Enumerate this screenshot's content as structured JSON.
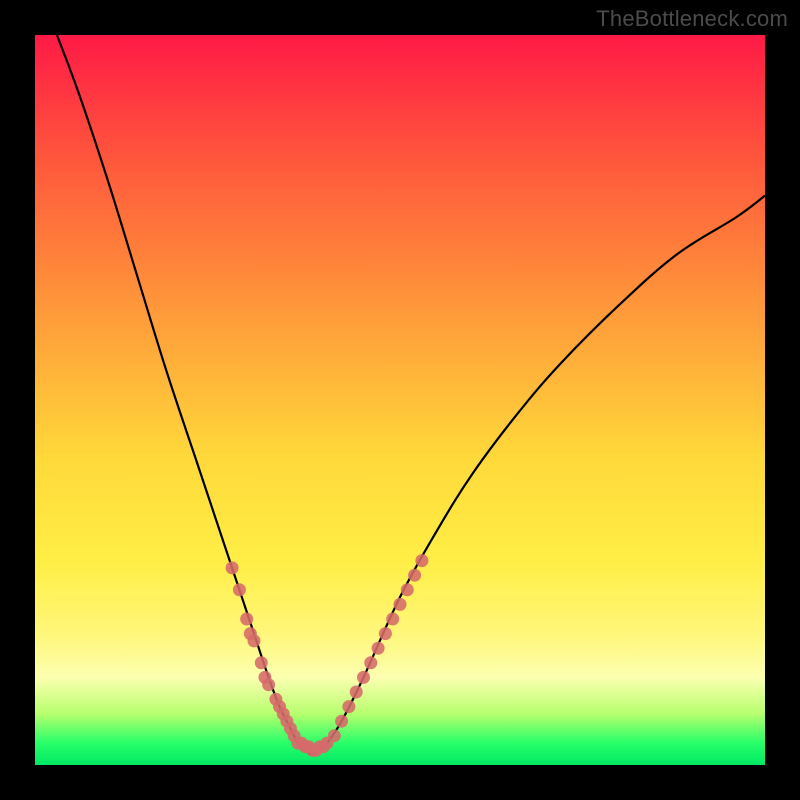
{
  "watermark": "TheBottleneck.com",
  "colors": {
    "frame": "#000000",
    "grad_top": "#ff1a46",
    "grad_red_orange": "#ff5a3c",
    "grad_orange": "#ff9a3a",
    "grad_yellow_upper": "#ffd93a",
    "grad_yellow": "#ffee45",
    "grad_yellow_pale": "#fff77a",
    "grad_yellow_white": "#fcffb0",
    "grad_green_light": "#b6ff6e",
    "grad_green": "#28ff6a",
    "grad_green_deep": "#00e864",
    "curve": "#000000",
    "markers": "#d66a6a"
  },
  "chart_data": {
    "type": "line",
    "title": "",
    "xlabel": "",
    "ylabel": "",
    "xlim": [
      0,
      100
    ],
    "ylim": [
      0,
      100
    ],
    "grid": false,
    "series": [
      {
        "name": "bottleneck_curve",
        "x": [
          3,
          6,
          10,
          14,
          18,
          22,
          25,
          28,
          30,
          32,
          33.5,
          35,
          36,
          37,
          38,
          39,
          40,
          42,
          45,
          50,
          55,
          60,
          66,
          72,
          80,
          88,
          96,
          100
        ],
        "y": [
          100,
          92,
          80,
          67,
          54,
          42,
          33,
          24,
          18,
          12,
          8,
          5,
          3,
          2,
          1.5,
          2,
          3,
          6,
          12,
          23,
          32,
          40,
          48,
          55,
          63,
          70,
          75,
          78
        ]
      }
    ],
    "markers": [
      {
        "x": 27,
        "y": 27
      },
      {
        "x": 28,
        "y": 24
      },
      {
        "x": 29,
        "y": 20
      },
      {
        "x": 29.5,
        "y": 18
      },
      {
        "x": 30,
        "y": 17
      },
      {
        "x": 31,
        "y": 14
      },
      {
        "x": 31.5,
        "y": 12
      },
      {
        "x": 32,
        "y": 11
      },
      {
        "x": 33,
        "y": 9
      },
      {
        "x": 33.5,
        "y": 8
      },
      {
        "x": 34,
        "y": 7
      },
      {
        "x": 34.5,
        "y": 6
      },
      {
        "x": 35,
        "y": 5
      },
      {
        "x": 35.5,
        "y": 4
      },
      {
        "x": 36,
        "y": 3
      },
      {
        "x": 36.5,
        "y": 3
      },
      {
        "x": 37,
        "y": 2.5
      },
      {
        "x": 37.5,
        "y": 2.5
      },
      {
        "x": 38,
        "y": 2
      },
      {
        "x": 38.5,
        "y": 2
      },
      {
        "x": 39,
        "y": 2.5
      },
      {
        "x": 39.5,
        "y": 2.5
      },
      {
        "x": 40,
        "y": 3
      },
      {
        "x": 41,
        "y": 4
      },
      {
        "x": 42,
        "y": 6
      },
      {
        "x": 43,
        "y": 8
      },
      {
        "x": 44,
        "y": 10
      },
      {
        "x": 45,
        "y": 12
      },
      {
        "x": 46,
        "y": 14
      },
      {
        "x": 47,
        "y": 16
      },
      {
        "x": 48,
        "y": 18
      },
      {
        "x": 49,
        "y": 20
      },
      {
        "x": 50,
        "y": 22
      },
      {
        "x": 51,
        "y": 24
      },
      {
        "x": 52,
        "y": 26
      },
      {
        "x": 53,
        "y": 28
      }
    ]
  }
}
